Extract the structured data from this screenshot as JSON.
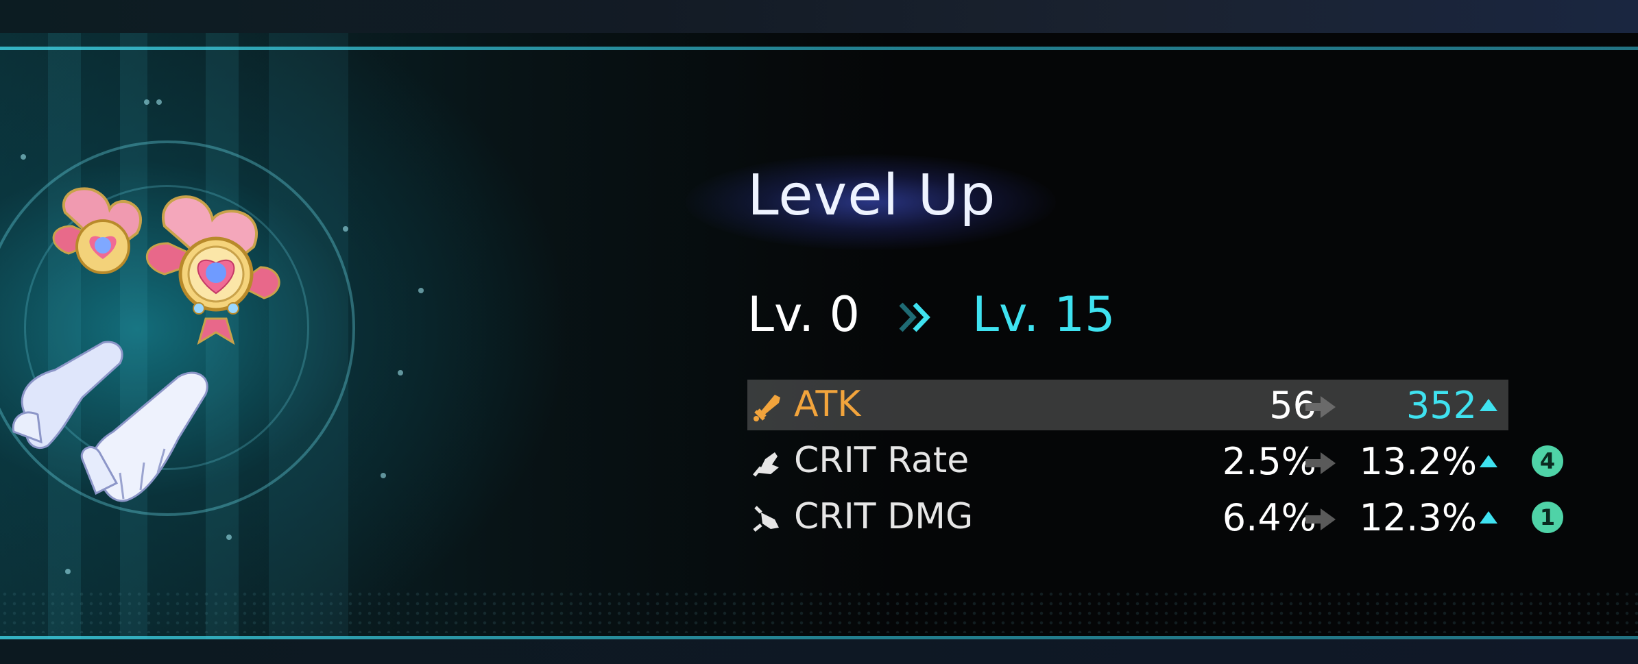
{
  "title": "Level Up",
  "level": {
    "from": "Lv. 0",
    "to": "Lv. 15"
  },
  "stats": [
    {
      "label": "ATK",
      "old": "56",
      "new": "352",
      "badge": "",
      "icon": "sword-icon",
      "highlight": true,
      "label_color": "#f2a43c",
      "new_color": "#3fe2f0"
    },
    {
      "label": "CRIT Rate",
      "old": "2.5%",
      "new": "13.2%",
      "badge": "4",
      "icon": "crit-rate-icon",
      "highlight": false
    },
    {
      "label": "CRIT DMG",
      "old": "6.4%",
      "new": "12.3%",
      "badge": "1",
      "icon": "crit-dmg-icon",
      "highlight": false
    }
  ],
  "item_icon": "gloves-relic-icon",
  "colors": {
    "accent_cyan": "#3fe2f0",
    "atk_orange": "#f2a43c",
    "badge_green": "#4fd3a7"
  }
}
